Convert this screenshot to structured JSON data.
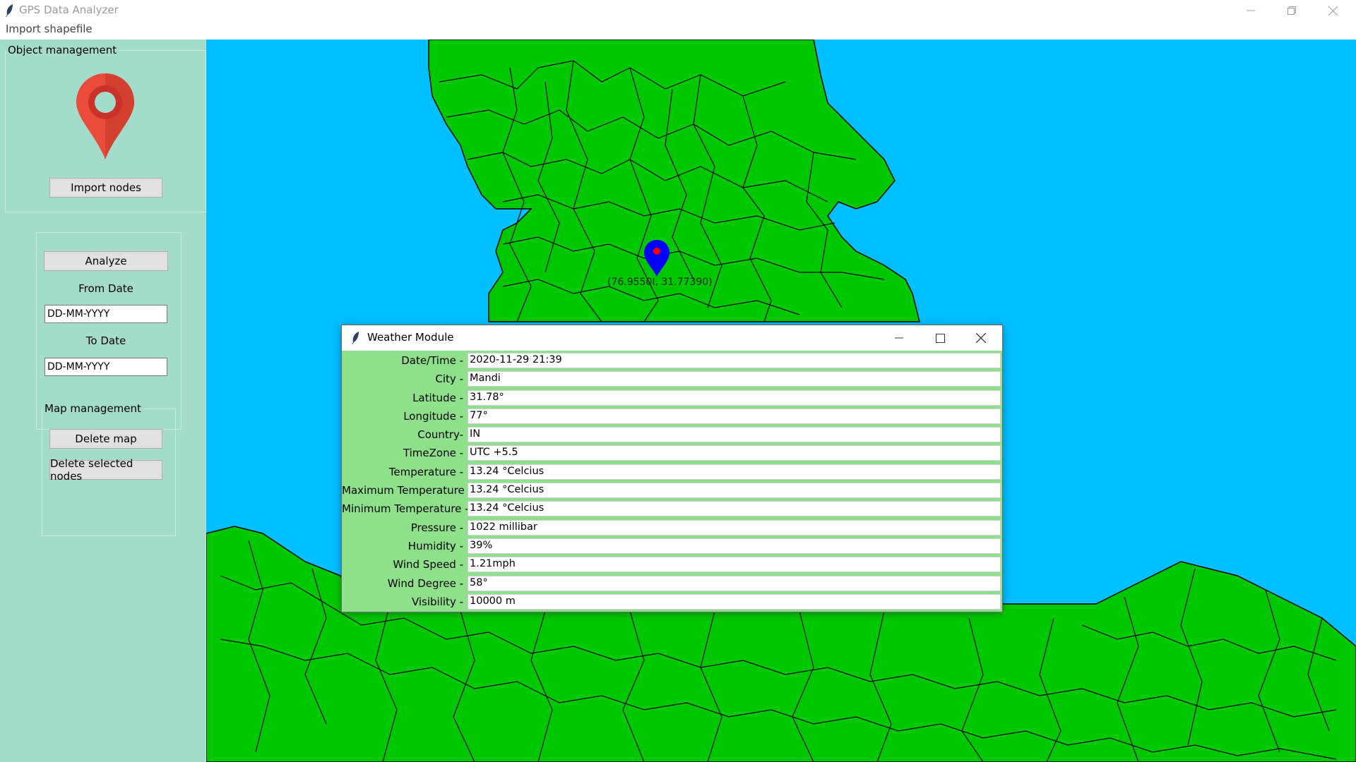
{
  "app": {
    "title": "GPS Data Analyzer",
    "icon": "feather-icon"
  },
  "menu": {
    "import_shapefile": "Import shapefile"
  },
  "sidebar": {
    "object_management": {
      "legend": "Object management",
      "icon": "location-pin-icon",
      "import_nodes": "Import nodes"
    },
    "analysis": {
      "analyze": "Analyze",
      "from_date_label": "From Date",
      "from_date_value": "DD-MM-YYYY",
      "to_date_label": "To Date",
      "to_date_value": "DD-MM-YYYY"
    },
    "map_management": {
      "legend": "Map management",
      "delete_map": "Delete map",
      "delete_selected_nodes": "Delete selected nodes"
    }
  },
  "map": {
    "marker_label": "(76.9550I, 31.77390)",
    "colors": {
      "water": "#00bfff",
      "land": "#00c800",
      "marker": "#0000ff",
      "marker_dot": "#ff0000",
      "sidebar": "#a4dccb"
    }
  },
  "weather": {
    "title": "Weather Module",
    "rows": [
      {
        "label": "Date/Time -",
        "value": "2020-11-29 21:39"
      },
      {
        "label": "City -",
        "value": "Mandi"
      },
      {
        "label": "Latitude -",
        "value": "31.78°"
      },
      {
        "label": "Longitude -",
        "value": "77°"
      },
      {
        "label": "Country-",
        "value": "IN"
      },
      {
        "label": "TimeZone -",
        "value": "UTC +5.5"
      },
      {
        "label": "Temperature -",
        "value": "13.24 °Celcius"
      },
      {
        "label": "Maximum Temperature -",
        "value": "13.24 °Celcius"
      },
      {
        "label": "Minimum Temperature -",
        "value": "13.24 °Celcius"
      },
      {
        "label": "Pressure -",
        "value": "1022 millibar"
      },
      {
        "label": "Humidity -",
        "value": "39%"
      },
      {
        "label": "Wind Speed -",
        "value": "1.21mph"
      },
      {
        "label": "Wind Degree -",
        "value": "58°"
      },
      {
        "label": "Visibility -",
        "value": "10000 m"
      }
    ]
  }
}
